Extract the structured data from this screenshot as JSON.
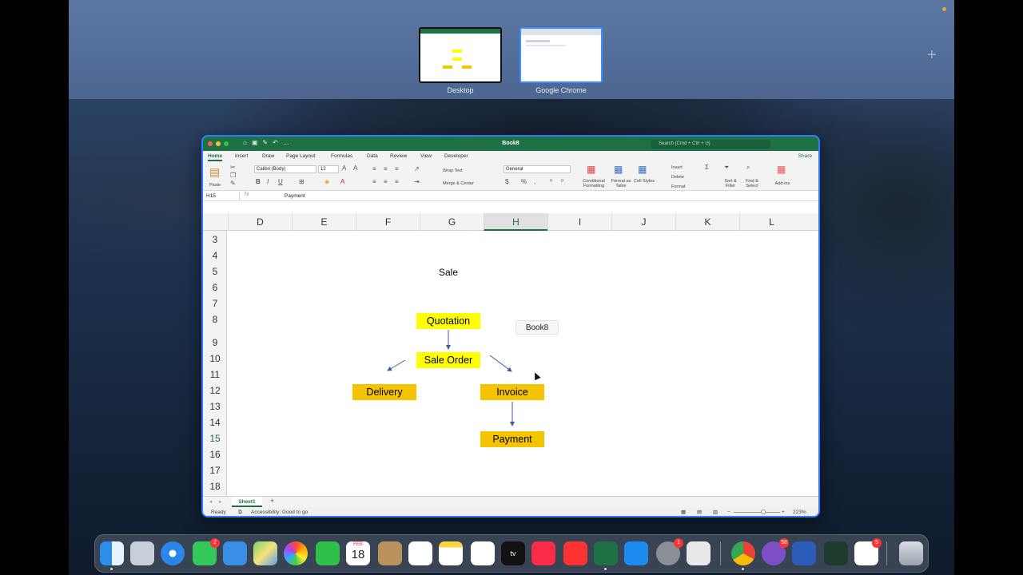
{
  "mission_control": {
    "spaces": [
      {
        "label": "Desktop"
      },
      {
        "label": "Google Chrome"
      }
    ]
  },
  "excel": {
    "title": "Book8",
    "search_placeholder": "Search (Cmd + Ctrl + U)",
    "tabs": [
      "Home",
      "Insert",
      "Draw",
      "Page Layout",
      "Formulas",
      "Data",
      "Review",
      "View",
      "Developer"
    ],
    "active_tab": "Home",
    "share_label": "Share",
    "ribbon": {
      "paste": "Paste",
      "font_name": "Calibri (Body)",
      "font_size": "12",
      "wrap_text": "Wrap Text",
      "merge_center": "Merge & Center",
      "number_format": "General",
      "conditional_formatting": "Conditional Formatting",
      "format_as_table": "Format as Table",
      "cell_styles": "Cell Styles",
      "insert": "Insert",
      "delete": "Delete",
      "format": "Format",
      "sort_filter": "Sort & Filter",
      "find_select": "Find & Select",
      "add_ins": "Add-ins"
    },
    "name_box": "H15",
    "fx": "fx",
    "formula_value": "Payment",
    "columns": [
      "D",
      "E",
      "F",
      "G",
      "H",
      "I",
      "J",
      "K",
      "L"
    ],
    "selected_column": "H",
    "rows": [
      "3",
      "4",
      "5",
      "6",
      "7",
      "8",
      "9",
      "10",
      "11",
      "12",
      "13",
      "14",
      "15",
      "16",
      "17",
      "18"
    ],
    "selected_row": "15",
    "cells": {
      "sale": "Sale"
    },
    "flow": {
      "quotation": "Quotation",
      "sale_order": "Sale Order",
      "delivery": "Delivery",
      "invoice": "Invoice",
      "payment": "Payment"
    },
    "tooltip": "Book8",
    "sheet_tab": "Sheet1",
    "status": {
      "ready": "Ready",
      "accessibility": "Accessibility: Good to go",
      "zoom": "223%"
    }
  },
  "dock": {
    "badges": {
      "messages": "2",
      "feb": "FEB",
      "day": "18",
      "settings": "1",
      "viber": "58",
      "setapp": "5"
    }
  }
}
